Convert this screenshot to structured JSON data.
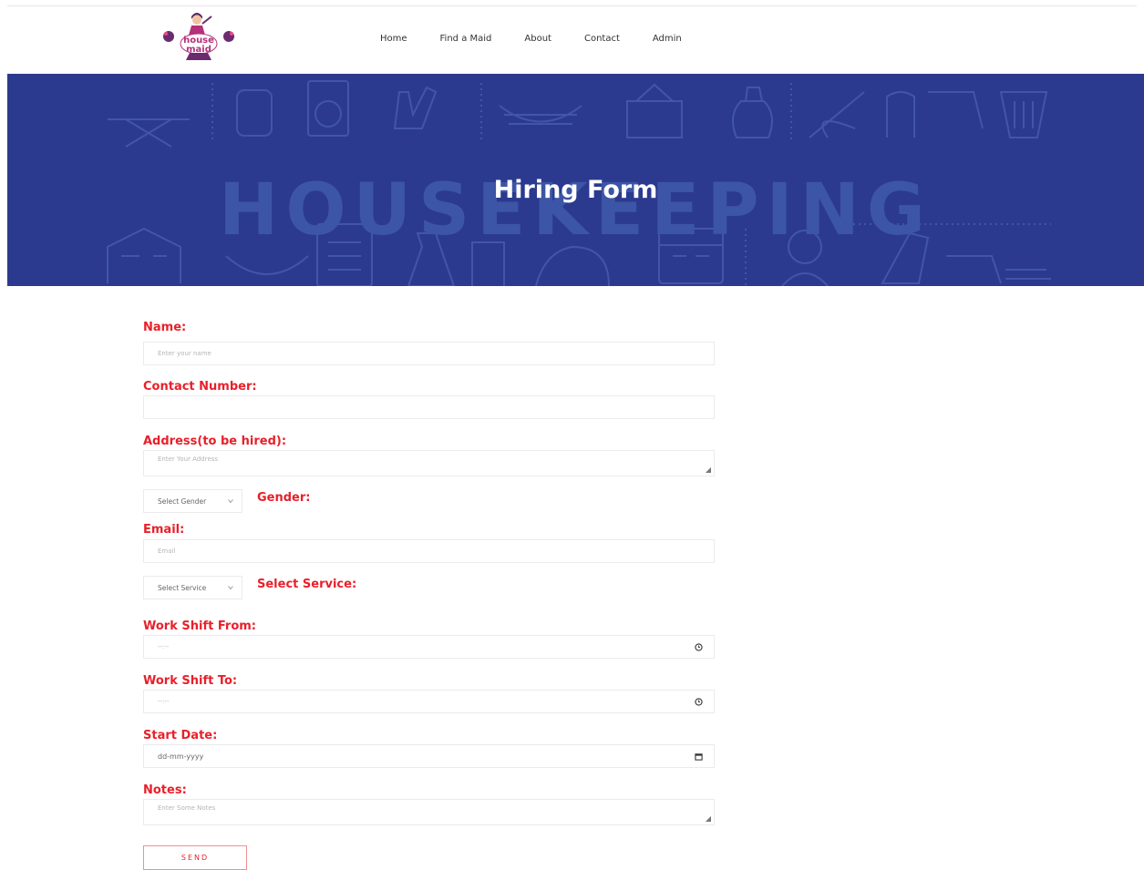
{
  "brand": {
    "logo_text_line1": "house",
    "logo_text_line2": "maid"
  },
  "nav": {
    "items": [
      "Home",
      "Find a Maid",
      "About",
      "Contact",
      "Admin"
    ]
  },
  "hero": {
    "background_word": "HOUSEKEEPING",
    "title": "Hiring Form"
  },
  "form": {
    "name_label": "Name:",
    "name_placeholder": "Enter your name",
    "contact_label": "Contact Number:",
    "contact_value": "",
    "address_label": "Address(to be hired):",
    "address_placeholder": "Enter Your Address",
    "gender_select": "Select Gender",
    "gender_label": "Gender:",
    "email_label": "Email:",
    "email_placeholder": "Email",
    "service_select": "Select Service",
    "service_label": "Select Service:",
    "shift_from_label": "Work Shift From:",
    "shift_from_value": "--:--",
    "shift_to_label": "Work Shift To:",
    "shift_to_value": "--:--",
    "start_date_label": "Start Date:",
    "start_date_value": "dd-mm-yyyy",
    "notes_label": "Notes:",
    "notes_placeholder": "Enter Some Notes",
    "send_label": "SEND"
  },
  "colors": {
    "accent": "#e8202a",
    "hero_bg": "#2b3a8f",
    "hero_word": "#3d55a6"
  }
}
